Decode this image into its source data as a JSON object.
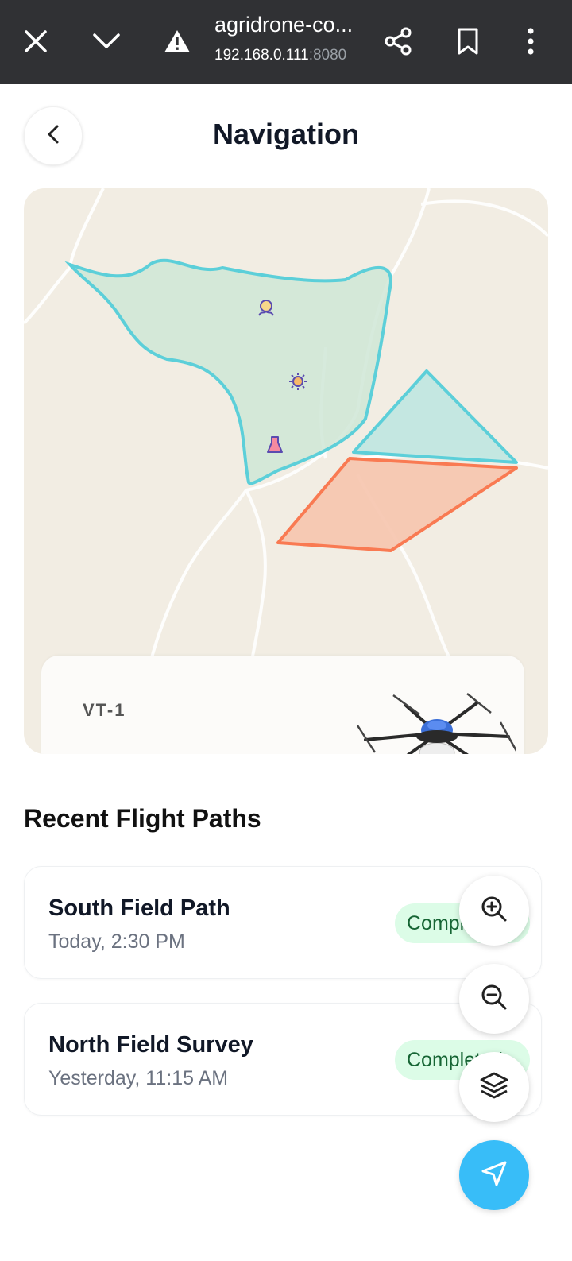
{
  "browser": {
    "host": "agridrone-co...",
    "address_ip": "192.168.0.111",
    "address_port": ":8080",
    "icons": [
      "close-icon",
      "chevron-down-icon",
      "warning-icon",
      "share-icon",
      "bookmark-icon",
      "more-vert-icon"
    ]
  },
  "header": {
    "title": "Navigation",
    "back_icon": "chevron-left-icon"
  },
  "map": {
    "fields": [
      {
        "name": "field-polygon-cyan-large",
        "color": "#5ccfd9"
      },
      {
        "name": "field-polygon-cyan-triangle",
        "color": "#5ccfd9"
      },
      {
        "name": "field-polygon-orange",
        "color": "#f97a52"
      }
    ],
    "markers": [
      "alien-marker-icon",
      "sun-marker-icon",
      "flask-marker-icon"
    ],
    "drone": {
      "id": "VT-1"
    }
  },
  "recent": {
    "title": "Recent Flight Paths",
    "items": [
      {
        "name": "South Field Path",
        "time": "Today, 2:30 PM",
        "status": "Completed"
      },
      {
        "name": "North Field Survey",
        "time": "Yesterday, 11:15 AM",
        "status": "Completed"
      }
    ]
  },
  "controls": {
    "buttons": [
      "zoom-in-icon",
      "zoom-out-icon",
      "layers-icon",
      "navigate-icon"
    ],
    "accent": "#38bdf8"
  }
}
